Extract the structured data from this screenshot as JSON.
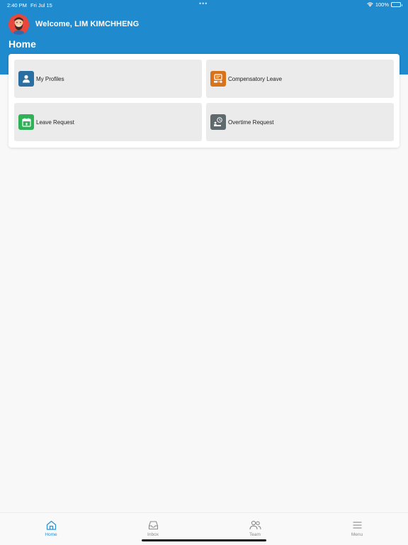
{
  "status_bar": {
    "time": "2:40 PM",
    "date": "Fri Jul 15",
    "battery": "100%"
  },
  "header": {
    "welcome": "Welcome, LIM KIMCHHENG",
    "title": "Home"
  },
  "colors": {
    "header_bg": "#1f8ace",
    "accent": "#2b8fd6"
  },
  "tiles": [
    {
      "label": "My Profiles",
      "icon": "user-profile-icon",
      "color": "#2a6fa1"
    },
    {
      "label": "Compensatory Leave",
      "icon": "compensatory-leave-icon",
      "color": "#d8731b"
    },
    {
      "label": "Leave Request",
      "icon": "calendar-icon",
      "color": "#2fb157"
    },
    {
      "label": "Overtime Request",
      "icon": "overtime-clock-icon",
      "color": "#5f6a6f"
    }
  ],
  "tabbar": {
    "active": "Home",
    "items": [
      {
        "label": "Home",
        "icon": "home-icon"
      },
      {
        "label": "Inbox",
        "icon": "inbox-icon"
      },
      {
        "label": "Team",
        "icon": "team-icon"
      },
      {
        "label": "Menu",
        "icon": "menu-icon"
      }
    ]
  }
}
